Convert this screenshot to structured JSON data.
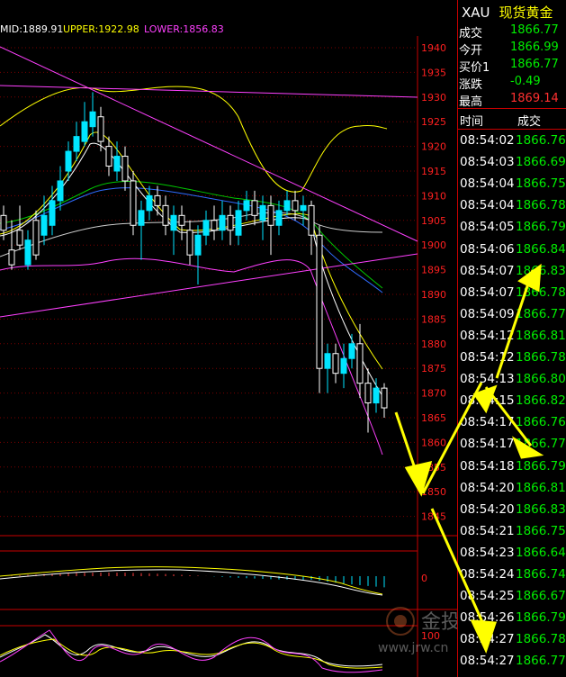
{
  "legend": {
    "mid": "MID:1889.91",
    "upper": "UPPER:1922.98",
    "lower": "LOWER:1856.83"
  },
  "colors": {
    "up": "#00e5ff",
    "down": "#ffffff",
    "mid": "#ffffff",
    "upper": "#ffff00",
    "lower": "#ff40ff",
    "axis": "#ff2020",
    "price_green": "#00ee00",
    "arrow": "#ffff00"
  },
  "axis": {
    "price_ticks": [
      "1940",
      "1935",
      "1930",
      "1925",
      "1920",
      "1915",
      "1910",
      "1905",
      "1900",
      "1895",
      "1890",
      "1885",
      "1880",
      "1875",
      "1870",
      "1865",
      "1860",
      "1855",
      "1850",
      "1845"
    ],
    "macd_zero": "0",
    "kdj_100": "100"
  },
  "panel": {
    "symbol": "XAU",
    "name": "现货黄金",
    "quotes": [
      {
        "label": "成交",
        "value": "1866.77",
        "color": "#00ee00"
      },
      {
        "label": "今开",
        "value": "1866.99",
        "color": "#00ee00"
      },
      {
        "label": "买价1",
        "value": "1866.77",
        "color": "#00ee00"
      },
      {
        "label": "涨跌",
        "value": "-0.49",
        "color": "#00ee00"
      },
      {
        "label": "最高",
        "value": "1869.14",
        "color": "#ff3030"
      }
    ],
    "header_time": "时间",
    "header_trade": "成交",
    "ticks": [
      {
        "time": "08:54:02",
        "price": "1866.76"
      },
      {
        "time": "08:54:03",
        "price": "1866.69"
      },
      {
        "time": "08:54:04",
        "price": "1866.75"
      },
      {
        "time": "08:54:04",
        "price": "1866.78"
      },
      {
        "time": "08:54:05",
        "price": "1866.79"
      },
      {
        "time": "08:54:06",
        "price": "1866.84"
      },
      {
        "time": "08:54:07",
        "price": "1866.83"
      },
      {
        "time": "08:54:07",
        "price": "1866.78"
      },
      {
        "time": "08:54:09",
        "price": "1866.77"
      },
      {
        "time": "08:54:12",
        "price": "1866.81"
      },
      {
        "time": "08:54:12",
        "price": "1866.78"
      },
      {
        "time": "08:54:13",
        "price": "1866.80"
      },
      {
        "time": "08:54:15",
        "price": "1866.82"
      },
      {
        "time": "08:54:17",
        "price": "1866.76"
      },
      {
        "time": "08:54:17",
        "price": "1866.77"
      },
      {
        "time": "08:54:18",
        "price": "1866.79"
      },
      {
        "time": "08:54:20",
        "price": "1866.81"
      },
      {
        "time": "08:54:20",
        "price": "1866.83"
      },
      {
        "time": "08:54:21",
        "price": "1866.75"
      },
      {
        "time": "08:54:23",
        "price": "1866.64"
      },
      {
        "time": "08:54:24",
        "price": "1866.74"
      },
      {
        "time": "08:54:25",
        "price": "1866.67"
      },
      {
        "time": "08:54:26",
        "price": "1866.79"
      },
      {
        "time": "08:54:27",
        "price": "1866.78"
      },
      {
        "time": "08:54:27",
        "price": "1866.77"
      }
    ]
  },
  "watermark": {
    "brand": "金投网",
    "url": "www.jrw.cn"
  }
}
